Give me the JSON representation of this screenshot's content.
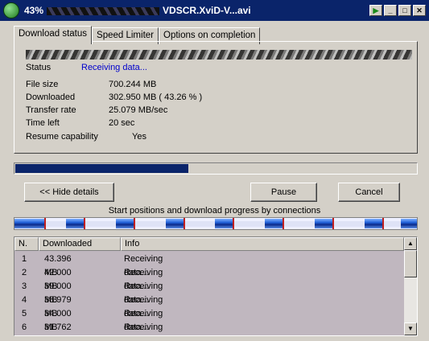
{
  "window": {
    "title_prefix": "43%",
    "title_suffix": "VDSCR.XviD-V...avi",
    "play_glyph": "▶",
    "minimize_glyph": "_",
    "maximize_glyph": "□",
    "close_glyph": "✕"
  },
  "tabs": [
    {
      "label": "Download status",
      "active": true
    },
    {
      "label": "Speed Limiter",
      "active": false
    },
    {
      "label": "Options on completion",
      "active": false
    }
  ],
  "status": {
    "label": "Status",
    "value": "Receiving data..."
  },
  "details": {
    "file_size_label": "File size",
    "file_size": "700.244  MB",
    "downloaded_label": "Downloaded",
    "downloaded": "302.950  MB  ( 43.26 % )",
    "rate_label": "Transfer rate",
    "rate": "25.079  MB/sec",
    "time_left_label": "Time left",
    "time_left": "20 sec",
    "resume_label": "Resume capability",
    "resume": "Yes"
  },
  "progress_fraction": 0.4326,
  "buttons": {
    "hide_details": "<< Hide details",
    "pause": "Pause",
    "cancel": "Cancel"
  },
  "connections_label": "Start positions and download progress by connections",
  "connections_table": {
    "headers": [
      "N.",
      "Downloaded",
      "Info"
    ],
    "rows": [
      {
        "n": "1",
        "downloaded": "43.396  MB",
        "info": "Receiving data..."
      },
      {
        "n": "2",
        "downloaded": "42.000  MB",
        "info": "Receiving data..."
      },
      {
        "n": "3",
        "downloaded": "39.000  MB",
        "info": "Receiving data..."
      },
      {
        "n": "4",
        "downloaded": "38.979  MB",
        "info": "Receiving data..."
      },
      {
        "n": "5",
        "downloaded": "34.000  MB",
        "info": "Receiving data..."
      },
      {
        "n": "6",
        "downloaded": "31.762  MB",
        "info": "Receiving data..."
      }
    ]
  },
  "colors": {
    "titlebar": "#0a246a",
    "progress_fill": "#0a246a",
    "status_text": "#0000cc",
    "list_background": "#c0b7bf"
  },
  "icons": {
    "app": "globe-download-icon",
    "scroll_up": "arrow-up-icon",
    "scroll_down": "arrow-down-icon"
  }
}
